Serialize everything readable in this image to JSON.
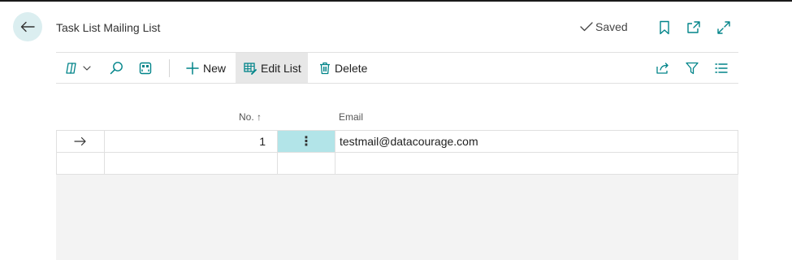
{
  "page": {
    "title": "Task List Mailing List",
    "saved_label": "Saved"
  },
  "header_icons": [
    "bookmark-icon",
    "open-new-window-icon",
    "expand-icon"
  ],
  "actionbar": {
    "new_label": "New",
    "edit_list_label": "Edit List",
    "delete_label": "Delete"
  },
  "table": {
    "columns": {
      "no": "No.",
      "no_sort": "↑",
      "email": "Email"
    },
    "rows": [
      {
        "no": "1",
        "menu": "⋮",
        "email": "testmail@datacourage.com"
      }
    ]
  },
  "colors": {
    "accent": "#008489",
    "back_button_bg": "#dbeef0",
    "selected_cell_bg": "#b2e4e8",
    "active_action_bg": "#e7e7e7"
  }
}
